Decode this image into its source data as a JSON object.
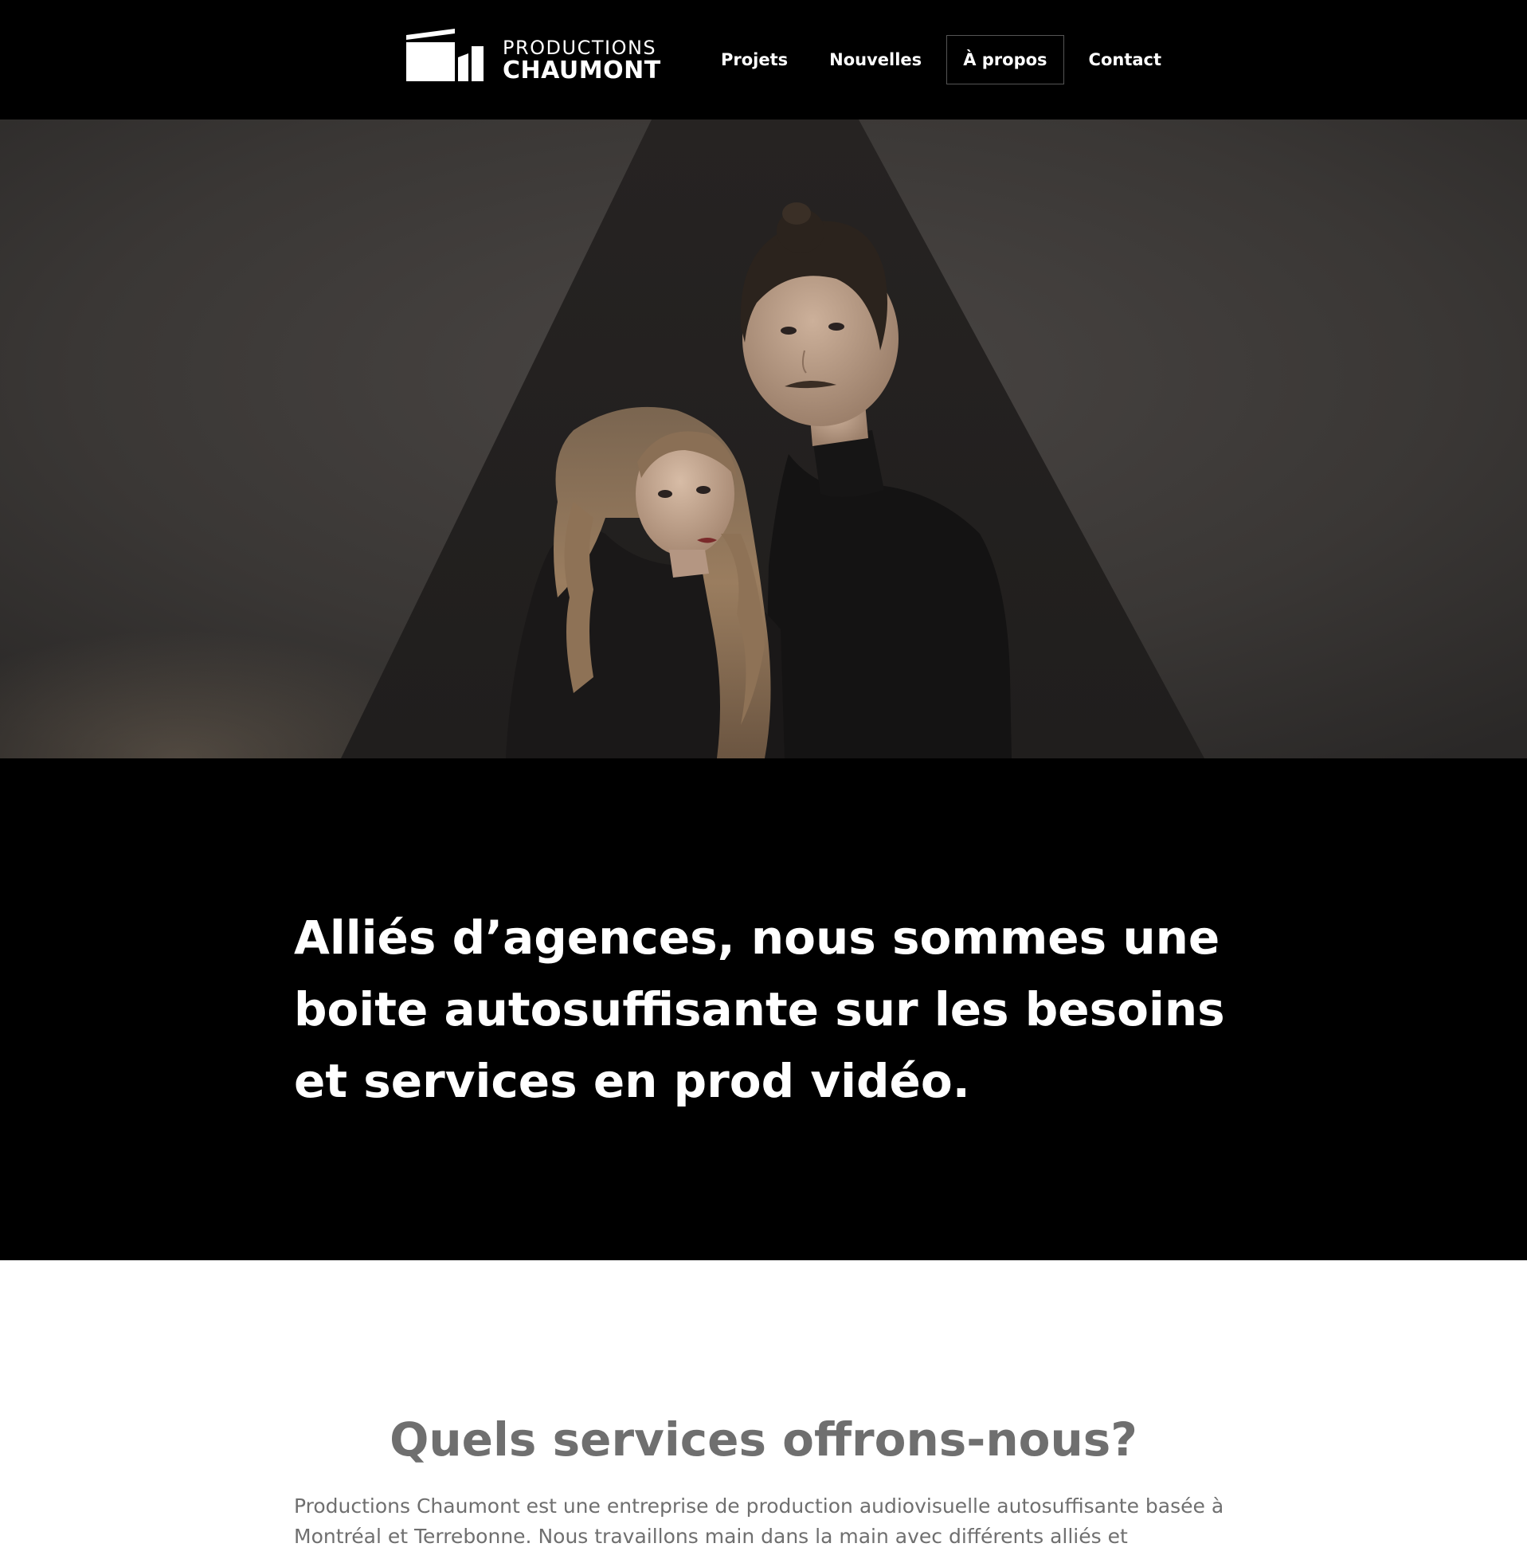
{
  "header": {
    "logo": {
      "line1": "PRODUCTIONS",
      "line2": "CHAUMONT"
    },
    "nav": [
      {
        "label": "Projets",
        "active": false
      },
      {
        "label": "Nouvelles",
        "active": false
      },
      {
        "label": "À propos",
        "active": true
      },
      {
        "label": "Contact",
        "active": false
      }
    ]
  },
  "hero": {
    "image": "portrait-of-two-people-in-black-against-dark-triangle-backdrop"
  },
  "tagline": {
    "text": "Alliés d’agences, nous sommes une boite autosuffisante sur les besoins et services en prod vidéo."
  },
  "services": {
    "title": "Quels services offrons-nous?",
    "intro": "Productions Chaumont est une entreprise de production audiovisuelle autosuffisante basée à Montréal et Terrebonne. Nous travaillons main dans la main avec différents alliés et"
  },
  "colors": {
    "header_bg": "#000000",
    "text_light": "#ffffff",
    "text_gray": "#6f6f6f",
    "active_border": "#555555"
  }
}
